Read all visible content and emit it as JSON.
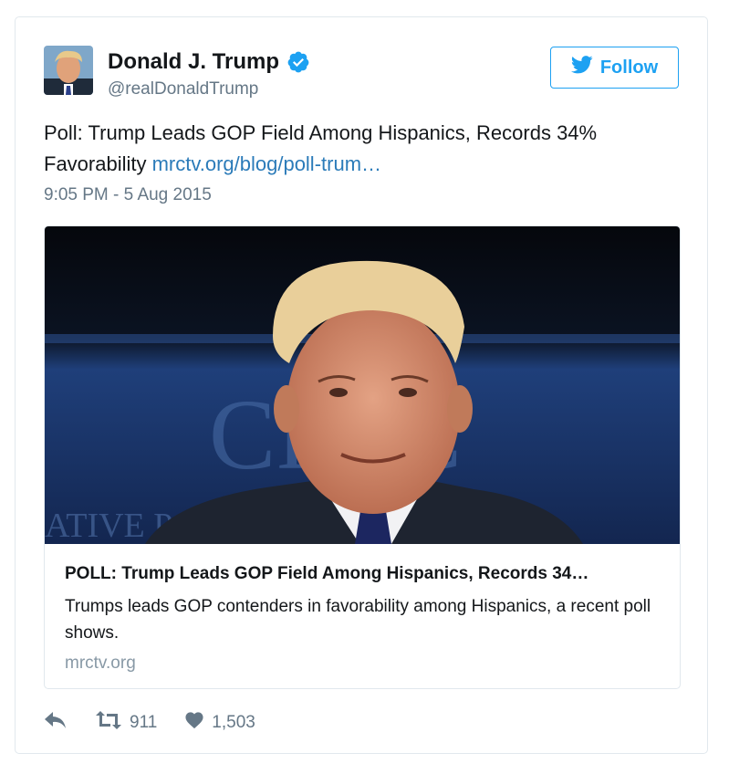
{
  "user": {
    "display_name": "Donald J. Trump",
    "handle": "@realDonaldTrump",
    "verified": true,
    "avatar_icon": "profile-photo"
  },
  "follow_button": {
    "label": "Follow",
    "icon": "twitter-bird-icon"
  },
  "tweet": {
    "text": "Poll: Trump Leads GOP Field Among Hispanics, Records 34% Favorability ",
    "link_text": "mrctv.org/blog/poll-trum…",
    "timestamp": "9:05 PM - 5 Aug 2015"
  },
  "link_card": {
    "image_banner_text": "CPAC",
    "image_banner_subtext": "ATIVE POLITICAL ACTION",
    "title": "POLL: Trump Leads GOP Field Among Hispanics, Records 34…",
    "description": "Trumps leads GOP contenders in favorability among Hispanics, a recent poll shows.",
    "domain": "mrctv.org"
  },
  "actions": {
    "reply_icon": "reply-icon",
    "retweet_icon": "retweet-icon",
    "retweet_count": "911",
    "like_icon": "heart-icon",
    "like_count": "1,503"
  },
  "colors": {
    "accent": "#1da1f2",
    "link": "#2b7bb9",
    "secondary_text": "#657786",
    "border": "#e1e8ed"
  }
}
